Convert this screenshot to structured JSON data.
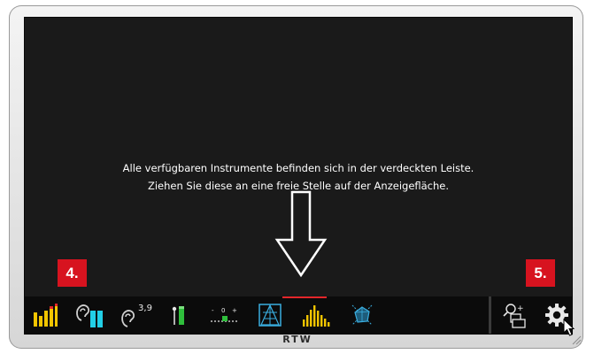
{
  "message": {
    "line1": "Alle verfügbaren Instrumente befinden sich in der verdeckten Leiste.",
    "line2": "Ziehen Sie diese an eine freie Stelle auf der Anzeigefläche."
  },
  "badges": {
    "left": "4.",
    "right": "5."
  },
  "toolbar": {
    "loudness_value": "3,9",
    "tools": [
      "ppm-meter-icon",
      "loudness-ear-bars-icon",
      "loudness-ear-value-icon",
      "true-peak-slider-icon",
      "correlation-scale-icon",
      "vectorscope-icon",
      "spectrum-analyzer-icon",
      "surround-sound-analyzer-icon"
    ]
  },
  "brand": {
    "logo": "RTW"
  },
  "colors": {
    "screen": "#1a1a1a",
    "badge": "#d7131f",
    "meter_yellow": "#f2c500",
    "meter_red": "#e3262a",
    "meter_cyan": "#22cfe6",
    "meter_green": "#2fbf3c",
    "vector_cyan": "#3aaee0"
  }
}
